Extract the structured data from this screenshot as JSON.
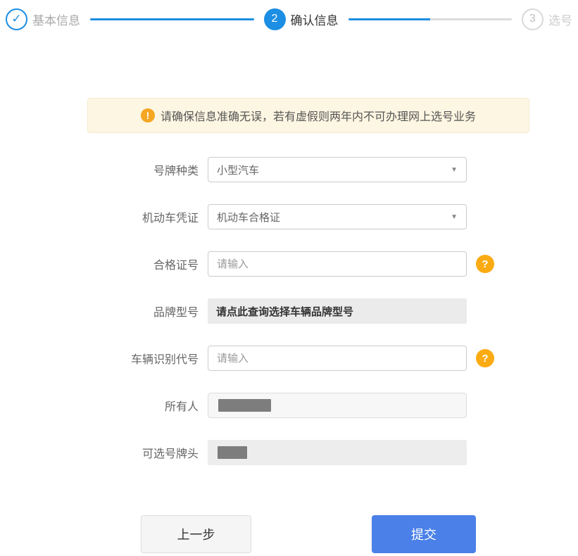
{
  "stepper": {
    "steps": [
      {
        "label": "基本信息",
        "state": "done"
      },
      {
        "label": "确认信息",
        "number": "2",
        "state": "current"
      },
      {
        "label": "选号",
        "number": "3",
        "state": "pending"
      }
    ]
  },
  "icons": {
    "check": "✓",
    "caret": "▼",
    "warning": "!",
    "help": "?"
  },
  "banner": {
    "text": "请确保信息准确无误，若有虚假则两年内不可办理网上选号业务"
  },
  "form": {
    "fields": [
      {
        "label": "号牌种类",
        "type": "select",
        "value": "小型汽车"
      },
      {
        "label": "机动车凭证",
        "type": "select",
        "value": "机动车合格证"
      },
      {
        "label": "合格证号",
        "type": "input",
        "placeholder": "请输入",
        "value": "",
        "help": true
      },
      {
        "label": "品牌型号",
        "type": "link-field",
        "value": "请点此查询选择车辆品牌型号"
      },
      {
        "label": "车辆识别代号",
        "type": "input",
        "placeholder": "请输入",
        "value": "",
        "help": true
      },
      {
        "label": "所有人",
        "type": "readonly",
        "redacted": true
      },
      {
        "label": "可选号牌头",
        "type": "readonly-flat",
        "redacted": true
      }
    ]
  },
  "actions": {
    "prev_label": "上一步",
    "submit_label": "提交"
  },
  "colors": {
    "accent_blue": "#1c8ee3",
    "submit_blue": "#4a80e8",
    "warning_orange": "#f5a623",
    "help_orange": "#fbab11",
    "banner_bg": "#fdf6e2"
  }
}
